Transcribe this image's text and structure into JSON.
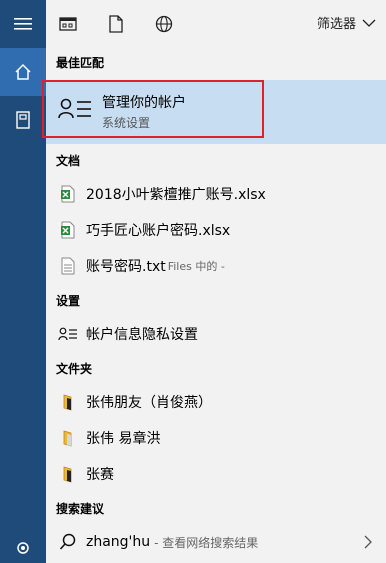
{
  "topbar": {
    "filter_label": "筛选器"
  },
  "sections": {
    "best_match": "最佳匹配",
    "documents": "文档",
    "settings": "设置",
    "folders": "文件夹",
    "suggestions": "搜索建议"
  },
  "best_match": {
    "title": "管理你的帐户",
    "subtitle": "系统设置"
  },
  "documents": [
    {
      "name": "2018小叶紫檀推广账号.xlsx"
    },
    {
      "name": "巧手匠心账户密码.xlsx"
    },
    {
      "name": "账号密码.txt",
      "note": "Files 中的 -"
    }
  ],
  "settings": [
    {
      "name": "帐户信息隐私设置"
    }
  ],
  "folders": [
    {
      "name": "张伟朋友（肖俊燕）"
    },
    {
      "name": "张伟 易章洪"
    },
    {
      "name": "张赛"
    }
  ],
  "suggestion": {
    "query": "zhang'hu",
    "hint": "- 查看网络搜索结果"
  },
  "colors": {
    "rail": "#1f4b7a",
    "rail_active": "#2f6db0",
    "highlight": "#c7ddf2",
    "outline": "#e0202a",
    "excel": "#2e8b3e"
  }
}
